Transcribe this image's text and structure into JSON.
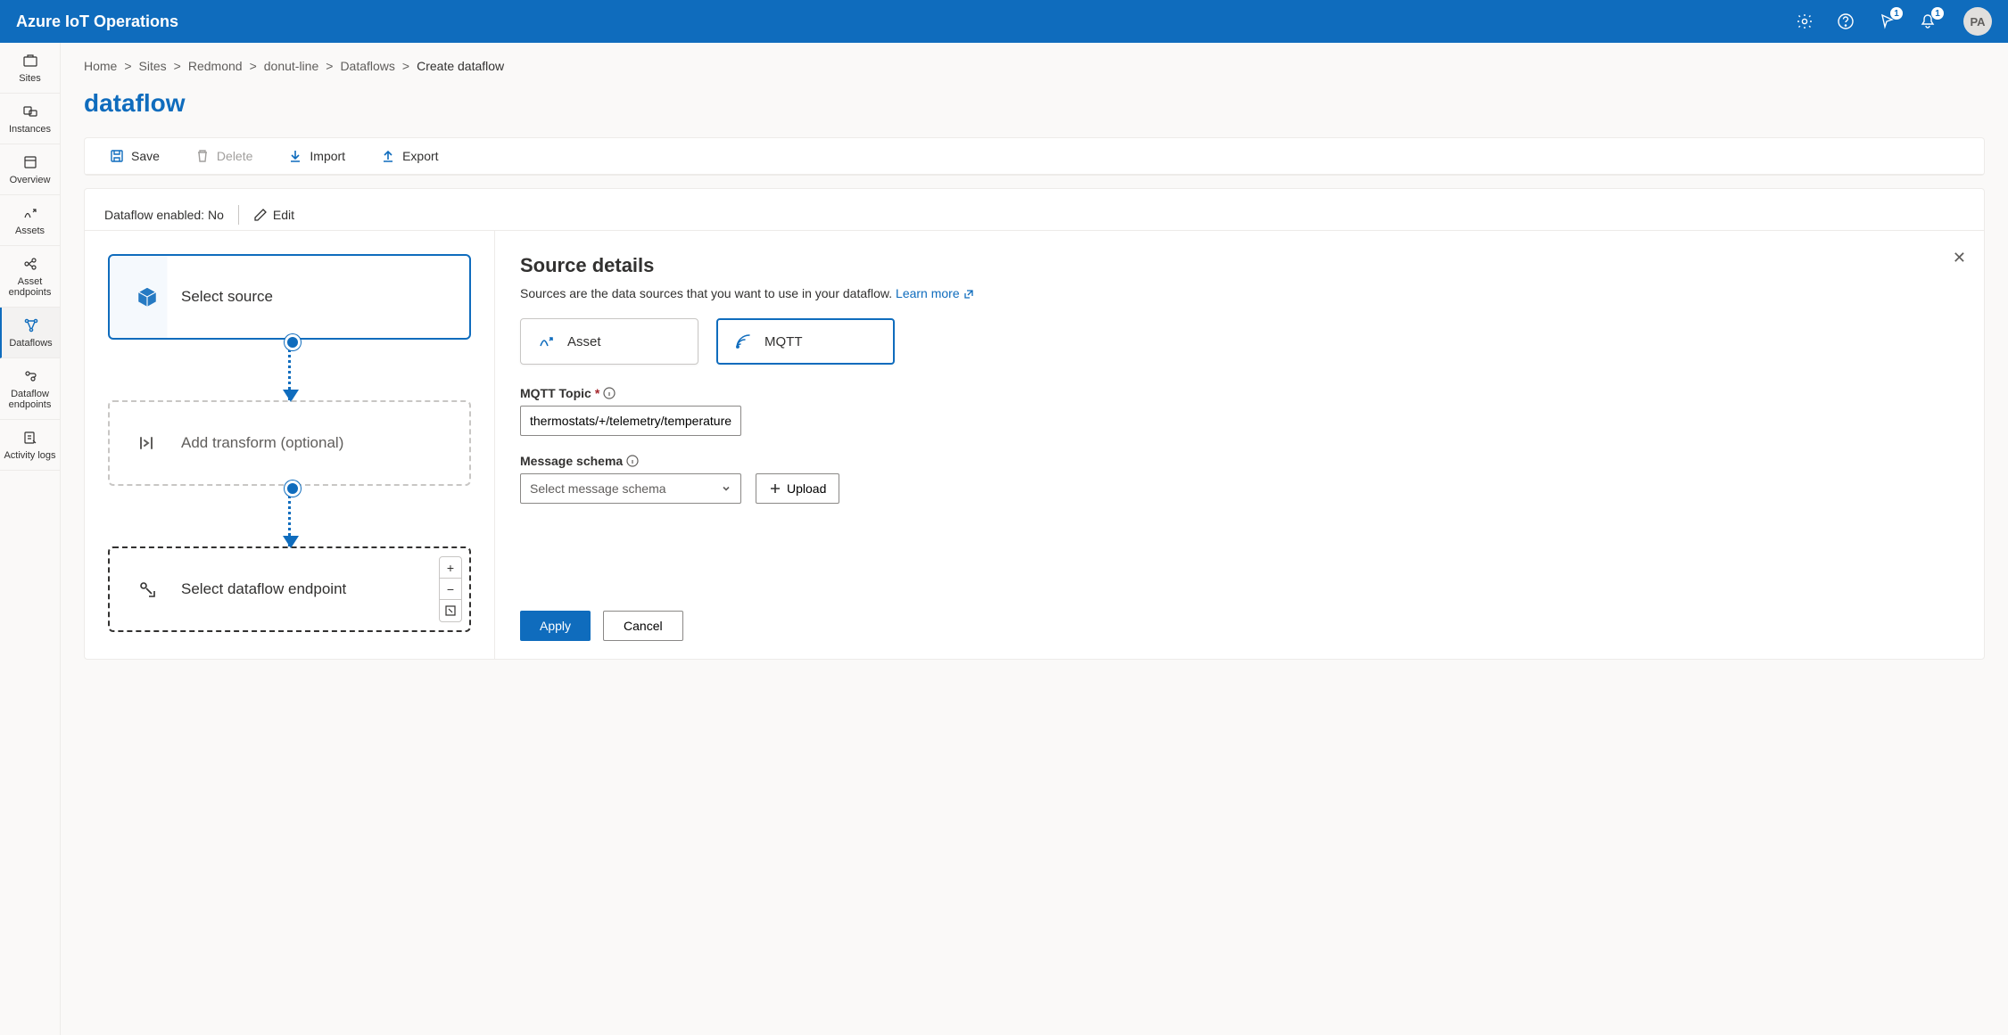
{
  "brand": "Azure IoT Operations",
  "header_badges": {
    "feedback": "1",
    "notifications": "1"
  },
  "avatar_initials": "PA",
  "rail": [
    {
      "label": "Sites"
    },
    {
      "label": "Instances"
    },
    {
      "label": "Overview"
    },
    {
      "label": "Assets"
    },
    {
      "label": "Asset endpoints"
    },
    {
      "label": "Dataflows"
    },
    {
      "label": "Dataflow endpoints"
    },
    {
      "label": "Activity logs"
    }
  ],
  "breadcrumb": [
    "Home",
    "Sites",
    "Redmond",
    "donut-line",
    "Dataflows",
    "Create dataflow"
  ],
  "page_title": "dataflow",
  "toolbar": {
    "save": "Save",
    "delete": "Delete",
    "import": "Import",
    "export": "Export"
  },
  "status": {
    "label": "Dataflow enabled:",
    "value": "No",
    "edit": "Edit"
  },
  "nodes": {
    "source": "Select source",
    "transform": "Add transform (optional)",
    "endpoint": "Select dataflow endpoint"
  },
  "details": {
    "title": "Source details",
    "desc": "Sources are the data sources that you want to use in your dataflow. ",
    "learn_more": "Learn more",
    "type_asset": "Asset",
    "type_mqtt": "MQTT",
    "topic_label": "MQTT Topic",
    "topic_value": "thermostats/+/telemetry/temperature/#",
    "schema_label": "Message schema",
    "schema_placeholder": "Select message schema",
    "upload": "Upload",
    "apply": "Apply",
    "cancel": "Cancel"
  }
}
